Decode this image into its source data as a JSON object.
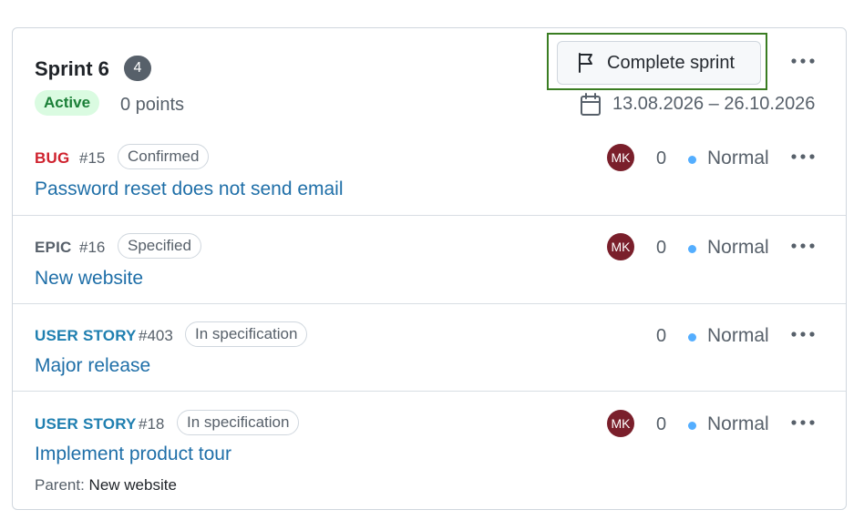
{
  "sprint": {
    "title": "Sprint 6",
    "count": "4",
    "status": "Active",
    "points": "0 points",
    "complete_label": "Complete sprint",
    "date_range": "13.08.2026 – 26.10.2026"
  },
  "items": [
    {
      "type": "BUG",
      "number": "#15",
      "status": "Confirmed",
      "title": "Password reset does not send email",
      "assignee": "MK",
      "estimate": "0",
      "priority": "Normal"
    },
    {
      "type": "EPIC",
      "number": "#16",
      "status": "Specified",
      "title": "New website",
      "assignee": "MK",
      "estimate": "0",
      "priority": "Normal"
    },
    {
      "type": "USER STORY",
      "number": "#403",
      "status": "In specification",
      "title": "Major release",
      "assignee": "",
      "estimate": "0",
      "priority": "Normal"
    },
    {
      "type": "USER STORY",
      "number": "#18",
      "status": "In specification",
      "title": "Implement product tour",
      "assignee": "MK",
      "estimate": "0",
      "priority": "Normal",
      "parent_label": "Parent:",
      "parent_value": "New website"
    }
  ],
  "colors": {
    "bug": "#cf222e",
    "story": "#1f7fb0",
    "avatar": "#7a1f2b",
    "active": "#1a7f37",
    "priority_dot": "#54aeff",
    "highlight_frame": "#3a7d22"
  },
  "icons": {
    "complete": "flag-icon",
    "date": "calendar-icon",
    "more": "more-horizontal-icon"
  }
}
